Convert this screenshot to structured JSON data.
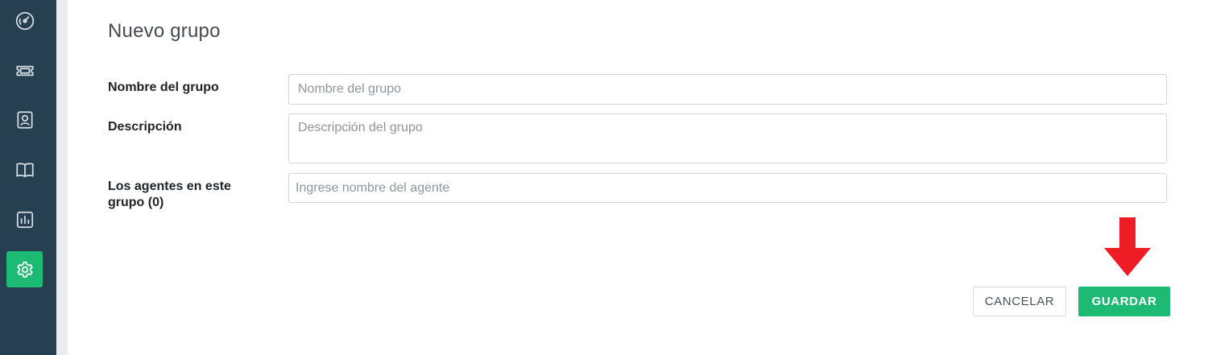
{
  "sidebar": {
    "items": [
      {
        "icon": "dashboard-gauge-icon",
        "active": false
      },
      {
        "icon": "ticket-icon",
        "active": false
      },
      {
        "icon": "contact-card-icon",
        "active": false
      },
      {
        "icon": "book-icon",
        "active": false
      },
      {
        "icon": "bar-chart-icon",
        "active": false
      },
      {
        "icon": "gear-icon",
        "active": true
      }
    ],
    "colors": {
      "background": "#264052",
      "active": "#1dba74",
      "icon": "#d6dee5"
    }
  },
  "form": {
    "title": "Nuevo grupo",
    "name_label": "Nombre del grupo",
    "name_placeholder": "Nombre del grupo",
    "name_value": "",
    "description_label": "Descripción",
    "description_placeholder": "Descripción del grupo",
    "description_value": "",
    "agents_label": "Los agentes en este grupo (0)",
    "agents_placeholder": "Ingrese nombre del agente",
    "agents_value": ""
  },
  "actions": {
    "cancel_label": "CANCELAR",
    "save_label": "GUARDAR"
  },
  "annotation": {
    "icon": "red-arrow-down-icon",
    "color": "#ee1c24"
  },
  "colors": {
    "accent": "#1dba74"
  }
}
